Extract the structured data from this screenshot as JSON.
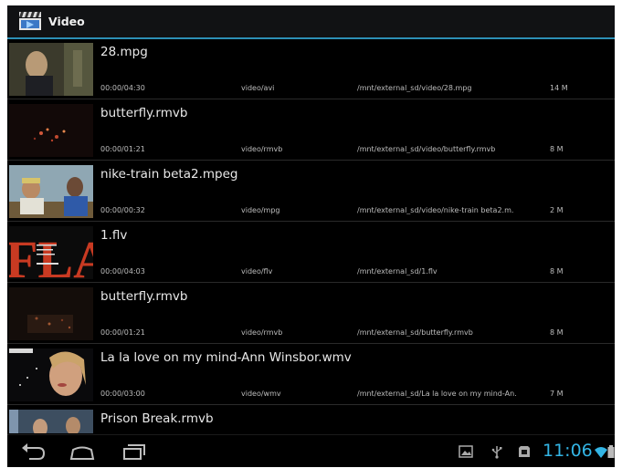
{
  "app": {
    "title": "Video"
  },
  "videos": [
    {
      "title": "28.mpg",
      "duration": "00:00/04:30",
      "type": "video/avi",
      "path": "/mnt/external_sd/video/28.mpg",
      "size": "14 M"
    },
    {
      "title": "butterfly.rmvb",
      "duration": "00:00/01:21",
      "type": "video/rmvb",
      "path": "/mnt/external_sd/video/butterfly.rmvb",
      "size": "8 M"
    },
    {
      "title": "nike-train beta2.mpeg",
      "duration": "00:00/00:32",
      "type": "video/mpg",
      "path": "/mnt/external_sd/video/nike-train beta2.m.",
      "size": "2 M"
    },
    {
      "title": "1.flv",
      "duration": "00:00/04:03",
      "type": "video/flv",
      "path": "/mnt/external_sd/1.flv",
      "size": "8 M"
    },
    {
      "title": "butterfly.rmvb",
      "duration": "00:00/01:21",
      "type": "video/rmvb",
      "path": "/mnt/external_sd/butterfly.rmvb",
      "size": "8 M"
    },
    {
      "title": "La la love on my mind-Ann Winsbor.wmv",
      "duration": "00:00/03:00",
      "type": "video/wmv",
      "path": "/mnt/external_sd/La la love on my mind-An.",
      "size": "7 M"
    },
    {
      "title": "Prison Break.rmvb"
    }
  ],
  "thumb_text": {
    "flv_big": "FLA"
  },
  "status": {
    "clock": "11:06"
  },
  "icons": {
    "app": "clapperboard-icon",
    "back": "back-icon",
    "home": "home-icon",
    "recents": "recent-apps-icon",
    "gallery": "gallery-notification-icon",
    "usb": "usb-icon",
    "sdcard": "sd-card-icon",
    "wifi": "wifi-icon",
    "battery": "battery-icon"
  },
  "colors": {
    "accent": "#33b5e5",
    "divider": "#2c8fb5",
    "background": "#000000"
  }
}
